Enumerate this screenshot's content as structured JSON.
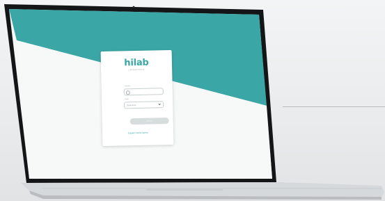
{
  "brand": {
    "name": "hilab",
    "tagline": "LABORATÓRIO",
    "accent": "#3aa7a6"
  },
  "login": {
    "field_user_label": "Usuário",
    "field_user_value": "",
    "field_select_label": "Perfil",
    "field_select_value": "Selecione",
    "submit_label": "Entrar",
    "forgot_link": "Esqueci minha senha"
  },
  "icons": {
    "user": "user-icon",
    "caret": "chevron-down-icon"
  },
  "colors": {
    "screen_top": "#3aa7a6",
    "screen_bottom": "#f7f8f8",
    "frame": "#141516",
    "body": "#d6d9db"
  }
}
